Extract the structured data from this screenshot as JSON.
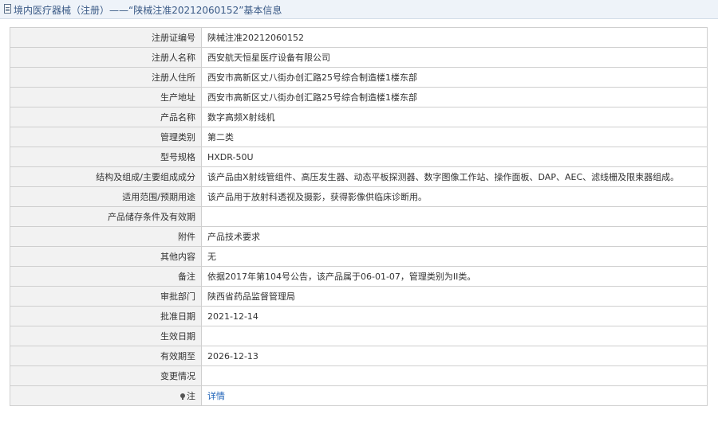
{
  "header": {
    "title": "境内医疗器械（注册）——“陕械注准20212060152”基本信息",
    "icon": "document-icon"
  },
  "rows": [
    {
      "label": "注册证编号",
      "value": "陕械注准20212060152"
    },
    {
      "label": "注册人名称",
      "value": "西安航天恒星医疗设备有限公司"
    },
    {
      "label": "注册人住所",
      "value": "西安市高新区丈八街办创汇路25号综合制造楼1楼东部"
    },
    {
      "label": "生产地址",
      "value": "西安市高新区丈八街办创汇路25号综合制造楼1楼东部"
    },
    {
      "label": "产品名称",
      "value": "数字高频X射线机"
    },
    {
      "label": "管理类别",
      "value": "第二类"
    },
    {
      "label": "型号规格",
      "value": "HXDR-50U"
    },
    {
      "label": "结构及组成/主要组成成分",
      "value": "该产品由X射线管组件、高压发生器、动态平板探测器、数字图像工作站、操作面板、DAP、AEC、滤线栅及限束器组成。"
    },
    {
      "label": "适用范围/预期用途",
      "value": "该产品用于放射科透视及摄影，获得影像供临床诊断用。"
    },
    {
      "label": "产品储存条件及有效期",
      "value": ""
    },
    {
      "label": "附件",
      "value": "产品技术要求"
    },
    {
      "label": "其他内容",
      "value": "无"
    },
    {
      "label": "备注",
      "value": "依据2017年第104号公告，该产品属于06-01-07，管理类别为II类。"
    },
    {
      "label": "审批部门",
      "value": "陕西省药品监督管理局"
    },
    {
      "label": "批准日期",
      "value": "2021-12-14"
    },
    {
      "label": "生效日期",
      "value": ""
    },
    {
      "label": "有效期至",
      "value": "2026-12-13"
    },
    {
      "label": "变更情况",
      "value": ""
    }
  ],
  "note_row": {
    "label": "注",
    "icon": "pin-icon",
    "link_text": "详情"
  },
  "colors": {
    "header_bg": "#eef3f9",
    "header_text": "#3a5a86",
    "label_bg": "#f2f2f2",
    "border": "#cfcfcf",
    "link": "#1f63b8"
  }
}
